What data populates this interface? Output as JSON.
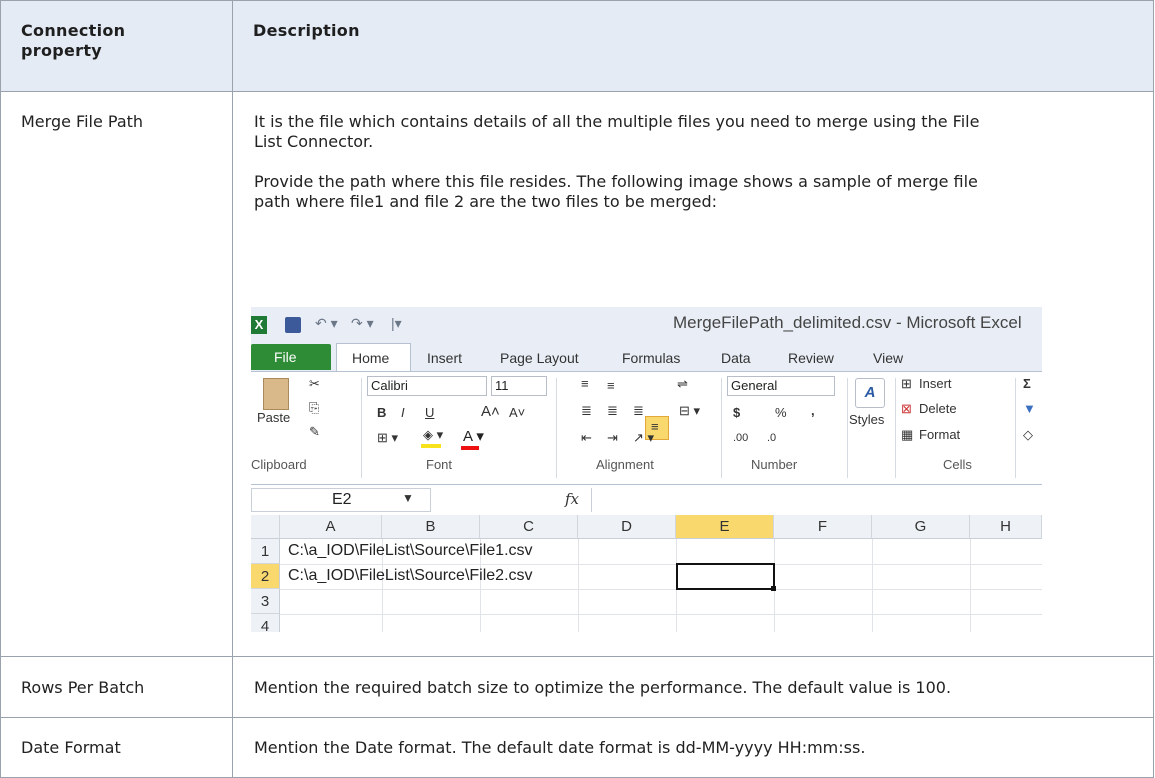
{
  "table": {
    "headers": [
      "Connection property",
      "Description"
    ],
    "header_line1": "Connection",
    "header_line2": "property",
    "rows": [
      {
        "property": "Merge File Path",
        "para1_line1": "It is the file which contains details of all the multiple files you need to merge using the File",
        "para1_line2": "List Connector.",
        "para2_line1": "Provide the path where this file resides. The following image shows a sample of merge file",
        "para2_line2": "path where file1 and file 2 are the two files to be merged:"
      },
      {
        "property": "Rows Per Batch",
        "description": "Mention the required batch size to optimize the performance. The default value is 100."
      },
      {
        "property": "Date Format",
        "description": "Mention the Date format. The default date format is dd-MM-yyyy HH:mm:ss."
      }
    ]
  },
  "excel": {
    "title": "MergeFilePath_delimited.csv - Microsoft Excel",
    "logo": "X",
    "tabs": [
      "File",
      "Home",
      "Insert",
      "Page Layout",
      "Formulas",
      "Data",
      "Review",
      "View"
    ],
    "ribbon": {
      "paste": "Paste",
      "font_name": "Calibri",
      "font_size": "11",
      "number_format": "General",
      "styles": "Styles",
      "insert": "Insert",
      "delete": "Delete",
      "format": "Format",
      "bold": "B",
      "italic": "I",
      "underline": "U",
      "currency": "$",
      "percent": "%",
      "comma": ",",
      "dec_inc": ".00",
      "dec_dec": ".0",
      "sum": "Σ",
      "groups": [
        "Clipboard",
        "Font",
        "Alignment",
        "Number",
        "Cells"
      ]
    },
    "name_box": "E2",
    "fx": "fx",
    "columns": [
      "A",
      "B",
      "C",
      "D",
      "E",
      "F",
      "G",
      "H"
    ],
    "rows": [
      "1",
      "2",
      "3",
      "4"
    ],
    "cells": {
      "A1": "C:\\a_IOD\\FileList\\Source\\File1.csv",
      "A2": "C:\\a_IOD\\FileList\\Source\\File2.csv"
    },
    "selected_cell": "E2",
    "accent_green": "#2e8b36",
    "selected_header_color": "#f9d86e"
  }
}
